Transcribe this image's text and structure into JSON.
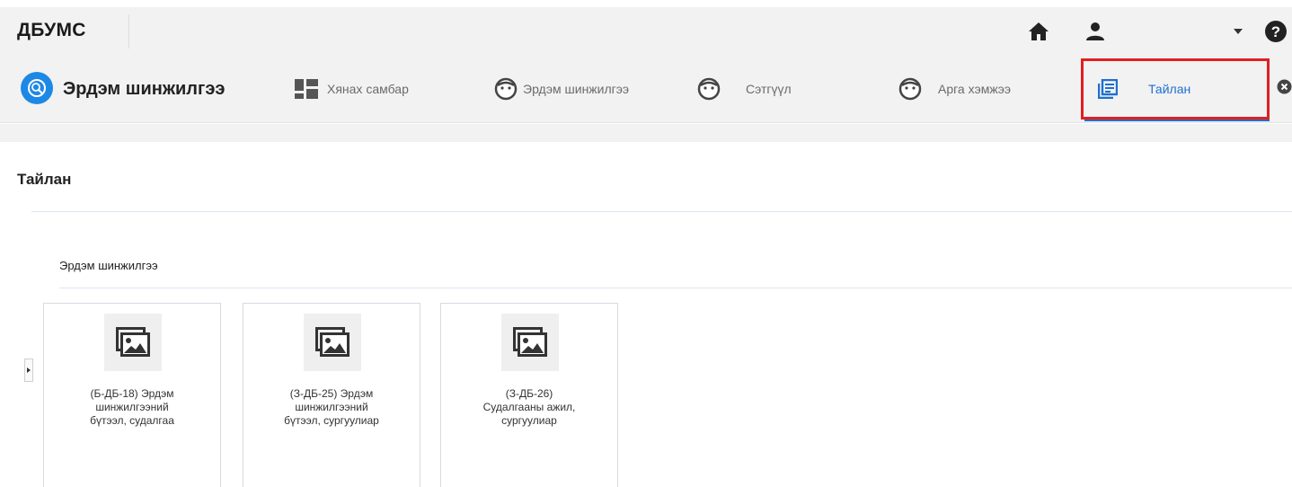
{
  "header": {
    "brand": "ДБУМС",
    "icons": [
      "home-icon",
      "user-icon",
      "dropdown-caret-icon",
      "help-icon"
    ]
  },
  "module": {
    "title": "Эрдэм шинжилгээ",
    "icon": "research-module-icon"
  },
  "nav": {
    "items": [
      {
        "label": "Хянах самбар",
        "icon": "dashboard-icon"
      },
      {
        "label": "Эрдэм шинжилгээ",
        "icon": "face-icon"
      },
      {
        "label": "Сэтгүүл",
        "icon": "face-icon"
      },
      {
        "label": "Арга хэмжээ",
        "icon": "face-icon"
      },
      {
        "label": "Тайлан",
        "icon": "report-icon",
        "active": true
      }
    ],
    "close_icon": "close-circle-icon"
  },
  "page": {
    "title": "Тайлан"
  },
  "section": {
    "title": "Эрдэм шинжилгээ",
    "cards": [
      {
        "label": "(Б-ДБ-18) Эрдэм\nшинжилгээний\nбүтээл, судалгаа",
        "icon": "image-placeholder-icon"
      },
      {
        "label": "(З-ДБ-25) Эрдэм\nшинжилгээний\nбүтээл, сургуулиар",
        "icon": "image-placeholder-icon"
      },
      {
        "label": "(З-ДБ-26)\nСудалгааны ажил,\nсургуулиар",
        "icon": "image-placeholder-icon"
      }
    ]
  },
  "colors": {
    "accent": "#1e6fd0",
    "highlight": "#e02020",
    "module_logo": "#1e88e5"
  }
}
